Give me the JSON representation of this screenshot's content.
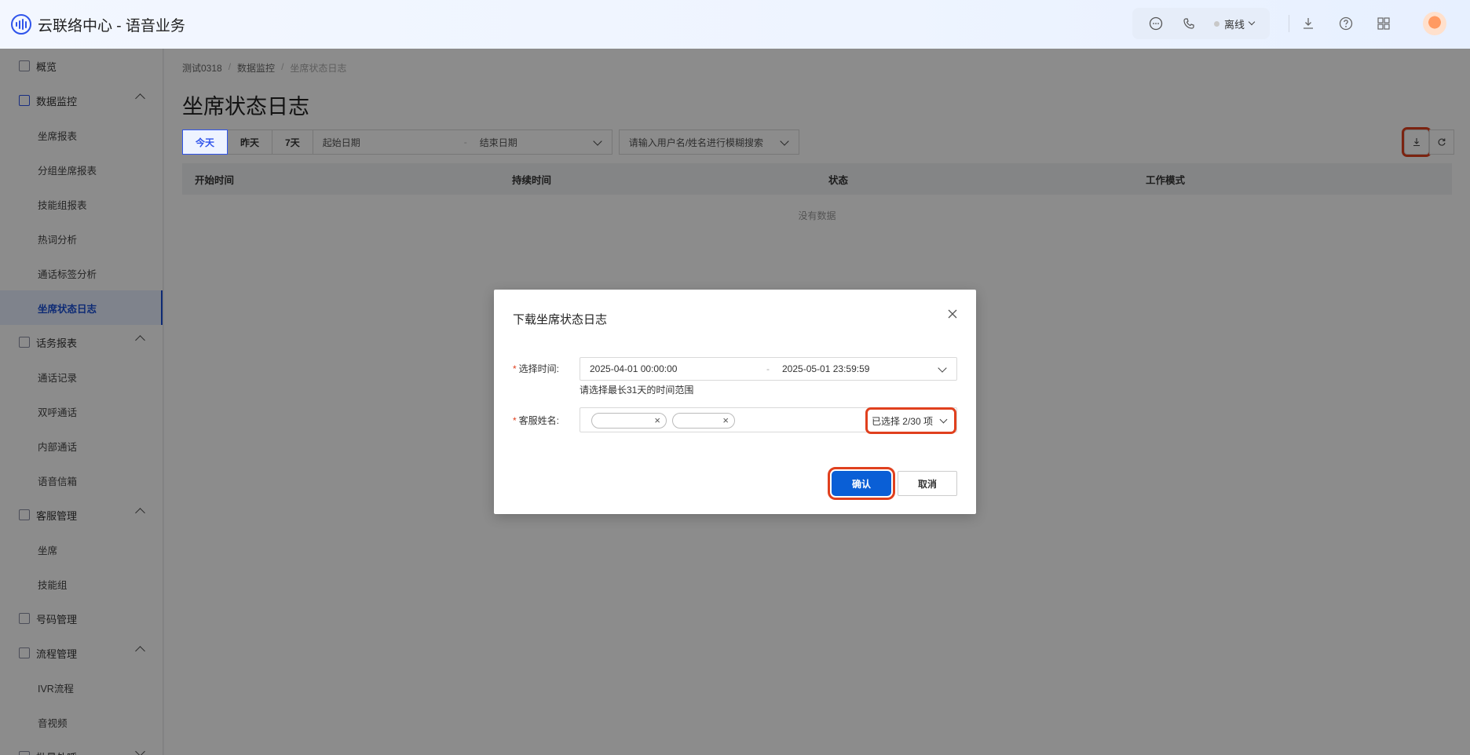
{
  "app": {
    "title": "云联络中心 - 语音业务"
  },
  "header": {
    "status_label": "离线",
    "icons": [
      "chat-icon",
      "phone-icon",
      "download-icon",
      "help-icon",
      "apps-grid-icon",
      "avatar"
    ]
  },
  "sidebar": {
    "items": [
      {
        "type": "group",
        "label": "概览",
        "icon": "overview-icon",
        "expandable": false
      },
      {
        "type": "group",
        "label": "数据监控",
        "icon": "monitor-icon",
        "expandable": true,
        "expanded": true
      },
      {
        "type": "sub",
        "label": "坐席报表"
      },
      {
        "type": "sub",
        "label": "分组坐席报表"
      },
      {
        "type": "sub",
        "label": "技能组报表"
      },
      {
        "type": "sub",
        "label": "热词分析"
      },
      {
        "type": "sub",
        "label": "通话标签分析"
      },
      {
        "type": "sub",
        "label": "坐席状态日志",
        "active": true
      },
      {
        "type": "group",
        "label": "话务报表",
        "icon": "report-icon",
        "expandable": true,
        "expanded": true
      },
      {
        "type": "sub",
        "label": "通话记录"
      },
      {
        "type": "sub",
        "label": "双呼通话"
      },
      {
        "type": "sub",
        "label": "内部通话"
      },
      {
        "type": "sub",
        "label": "语音信箱"
      },
      {
        "type": "group",
        "label": "客服管理",
        "icon": "headset-icon",
        "expandable": true,
        "expanded": true
      },
      {
        "type": "sub",
        "label": "坐席"
      },
      {
        "type": "sub",
        "label": "技能组"
      },
      {
        "type": "group",
        "label": "号码管理",
        "icon": "phone-number-icon",
        "expandable": false
      },
      {
        "type": "group",
        "label": "流程管理",
        "icon": "flow-icon",
        "expandable": true,
        "expanded": true
      },
      {
        "type": "sub",
        "label": "IVR流程"
      },
      {
        "type": "sub",
        "label": "音视频"
      },
      {
        "type": "group",
        "label": "批量外呼",
        "icon": "batch-call-icon",
        "expandable": true,
        "expanded": false
      }
    ]
  },
  "breadcrumb": [
    "测试0318",
    "数据监控",
    "坐席状态日志"
  ],
  "page": {
    "title": "坐席状态日志",
    "quick_dates": [
      "今天",
      "昨天",
      "7天"
    ],
    "date_start_placeholder": "起始日期",
    "date_end_placeholder": "结束日期",
    "date_sep": "-",
    "search_placeholder": "请输入用户名/姓名进行模糊搜索",
    "table_columns": [
      "开始时间",
      "持续时间",
      "状态",
      "工作模式"
    ],
    "empty_text": "没有数据"
  },
  "modal": {
    "title": "下载坐席状态日志",
    "time_label": "选择时间:",
    "time_start": "2025-04-01 00:00:00",
    "time_sep": "-",
    "time_end": "2025-05-01 23:59:59",
    "time_hint": "请选择最长31天的时间范围",
    "agent_label": "客服姓名:",
    "selected_count": "已选择 2/30 项",
    "confirm": "确认",
    "cancel": "取消"
  },
  "colors": {
    "primary": "#0a5fd6",
    "highlight": "#e0401e",
    "active_nav": "#1a4fd6"
  }
}
